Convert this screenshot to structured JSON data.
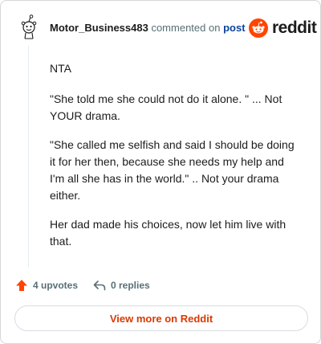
{
  "comment": {
    "username": "Motor_Business483",
    "verb": "commented on",
    "target_link": "post",
    "paragraphs": [
      "NTA",
      "\"She told me she could not do it alone. \" ... Not YOUR drama.",
      "\"She called me selfish and said I should be doing it for her then, because she needs my help and I'm all she has in the world.\" .. Not your drama either.",
      "Her dad made his choices, now let him live with that."
    ]
  },
  "brand": {
    "wordmark": "reddit",
    "color": "#ff4500"
  },
  "actions": {
    "upvotes_label": "4 upvotes",
    "replies_label": "0 replies",
    "upvote_icon": "upvote-arrow-icon",
    "reply_icon": "reply-arrow-icon",
    "upvote_color": "#ff4500"
  },
  "footer": {
    "view_more_label": "View more on Reddit",
    "accent": "#d93a00"
  }
}
